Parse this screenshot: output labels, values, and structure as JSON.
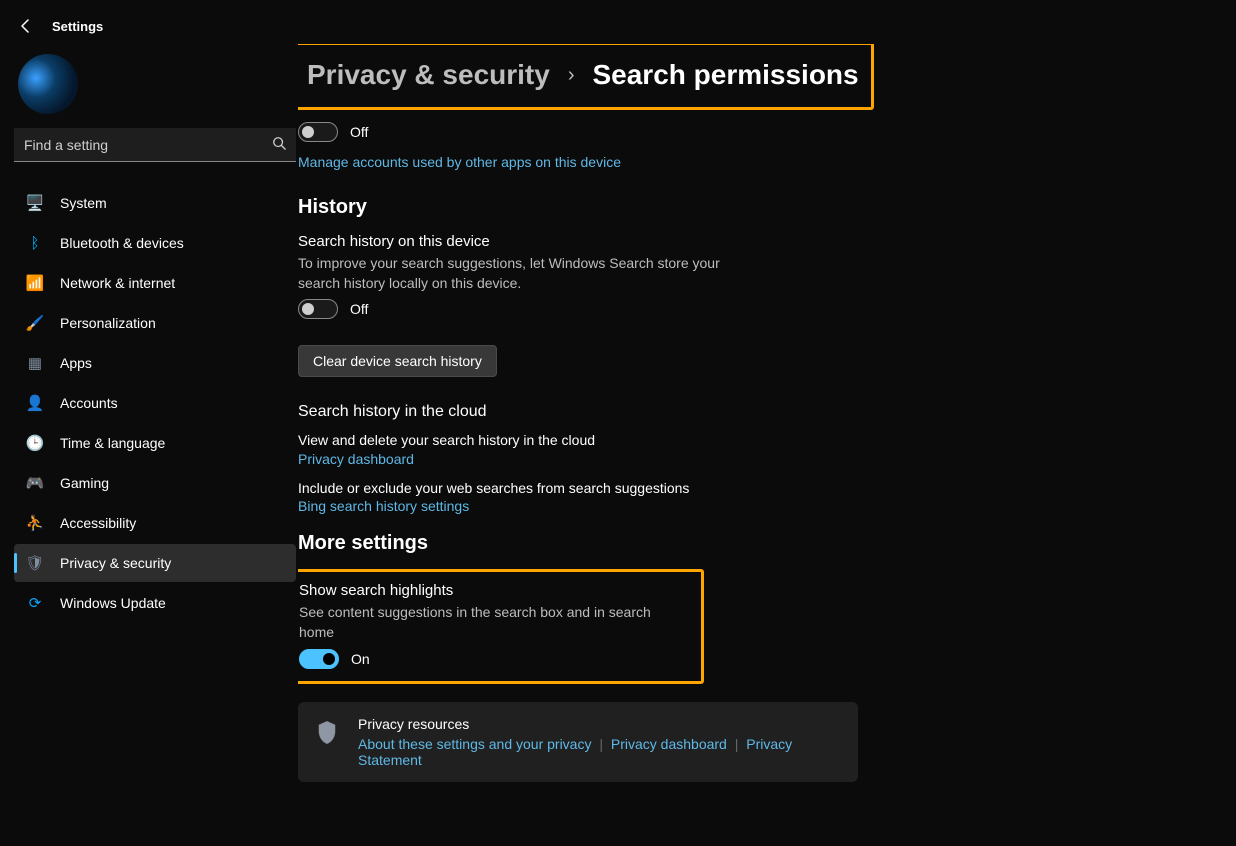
{
  "app": {
    "title": "Settings"
  },
  "search": {
    "placeholder": "Find a setting"
  },
  "nav": {
    "items": [
      {
        "label": "System",
        "icon": "🖥️"
      },
      {
        "label": "Bluetooth & devices",
        "icon": "ᛒ"
      },
      {
        "label": "Network & internet",
        "icon": "📶"
      },
      {
        "label": "Personalization",
        "icon": "🖌️"
      },
      {
        "label": "Apps",
        "icon": "▦"
      },
      {
        "label": "Accounts",
        "icon": "👤"
      },
      {
        "label": "Time & language",
        "icon": "🕒"
      },
      {
        "label": "Gaming",
        "icon": "🎮"
      },
      {
        "label": "Accessibility",
        "icon": "⛹"
      },
      {
        "label": "Privacy & security",
        "icon": "🛡"
      },
      {
        "label": "Windows Update",
        "icon": "⟳"
      }
    ],
    "active_index": 9
  },
  "breadcrumb": {
    "parent": "Privacy & security",
    "sep": "›",
    "current": "Search permissions"
  },
  "top_toggle": {
    "state_label": "Off"
  },
  "manage_accounts_link": "Manage accounts used by other apps on this device",
  "history": {
    "heading": "History",
    "device": {
      "title": "Search history on this device",
      "desc": "To improve your search suggestions, let Windows Search store your search history locally on this device.",
      "state_label": "Off",
      "clear_btn": "Clear device search history"
    },
    "cloud": {
      "title": "Search history in the cloud",
      "view_delete": "View and delete your search history in the cloud",
      "privacy_dashboard_link": "Privacy dashboard",
      "include_exclude": "Include or exclude your web searches from search suggestions",
      "bing_link": "Bing search history settings"
    }
  },
  "more": {
    "heading": "More settings",
    "highlights": {
      "title": "Show search highlights",
      "desc": "See content suggestions in the search box and in search home",
      "state_label": "On"
    }
  },
  "footer": {
    "title": "Privacy resources",
    "links": {
      "about": "About these settings and your privacy",
      "dashboard": "Privacy dashboard",
      "statement": "Privacy Statement"
    }
  }
}
